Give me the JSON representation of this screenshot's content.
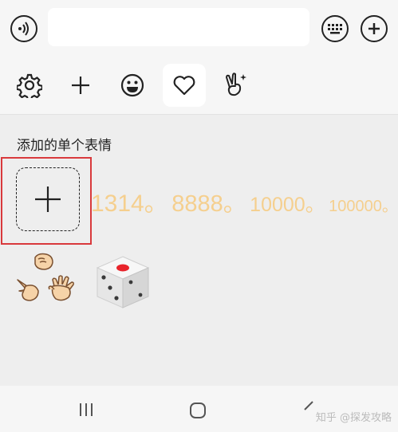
{
  "toolbar": {
    "voice_icon": "voice-input-icon",
    "keyboard_icon": "keyboard-icon",
    "plus_icon": "plus-icon"
  },
  "tabs": [
    {
      "icon": "gear-icon",
      "active": false
    },
    {
      "icon": "add-icon",
      "active": false
    },
    {
      "icon": "smiley-icon",
      "active": false
    },
    {
      "icon": "heart-icon",
      "active": true
    },
    {
      "icon": "victory-hand-icon",
      "active": false
    }
  ],
  "section": {
    "title": "添加的单个表情",
    "hint_numbers": [
      "1314。",
      "8888。",
      "10000。",
      "100000。"
    ]
  },
  "emojis": [
    {
      "name": "rock-paper-scissors-emoji"
    },
    {
      "name": "dice-emoji"
    }
  ],
  "watermark": "知乎 @探发攻略",
  "colors": {
    "highlight": "#d9393c",
    "hint_text": "#f5cf8e",
    "dice_pip": "#e8242b"
  }
}
